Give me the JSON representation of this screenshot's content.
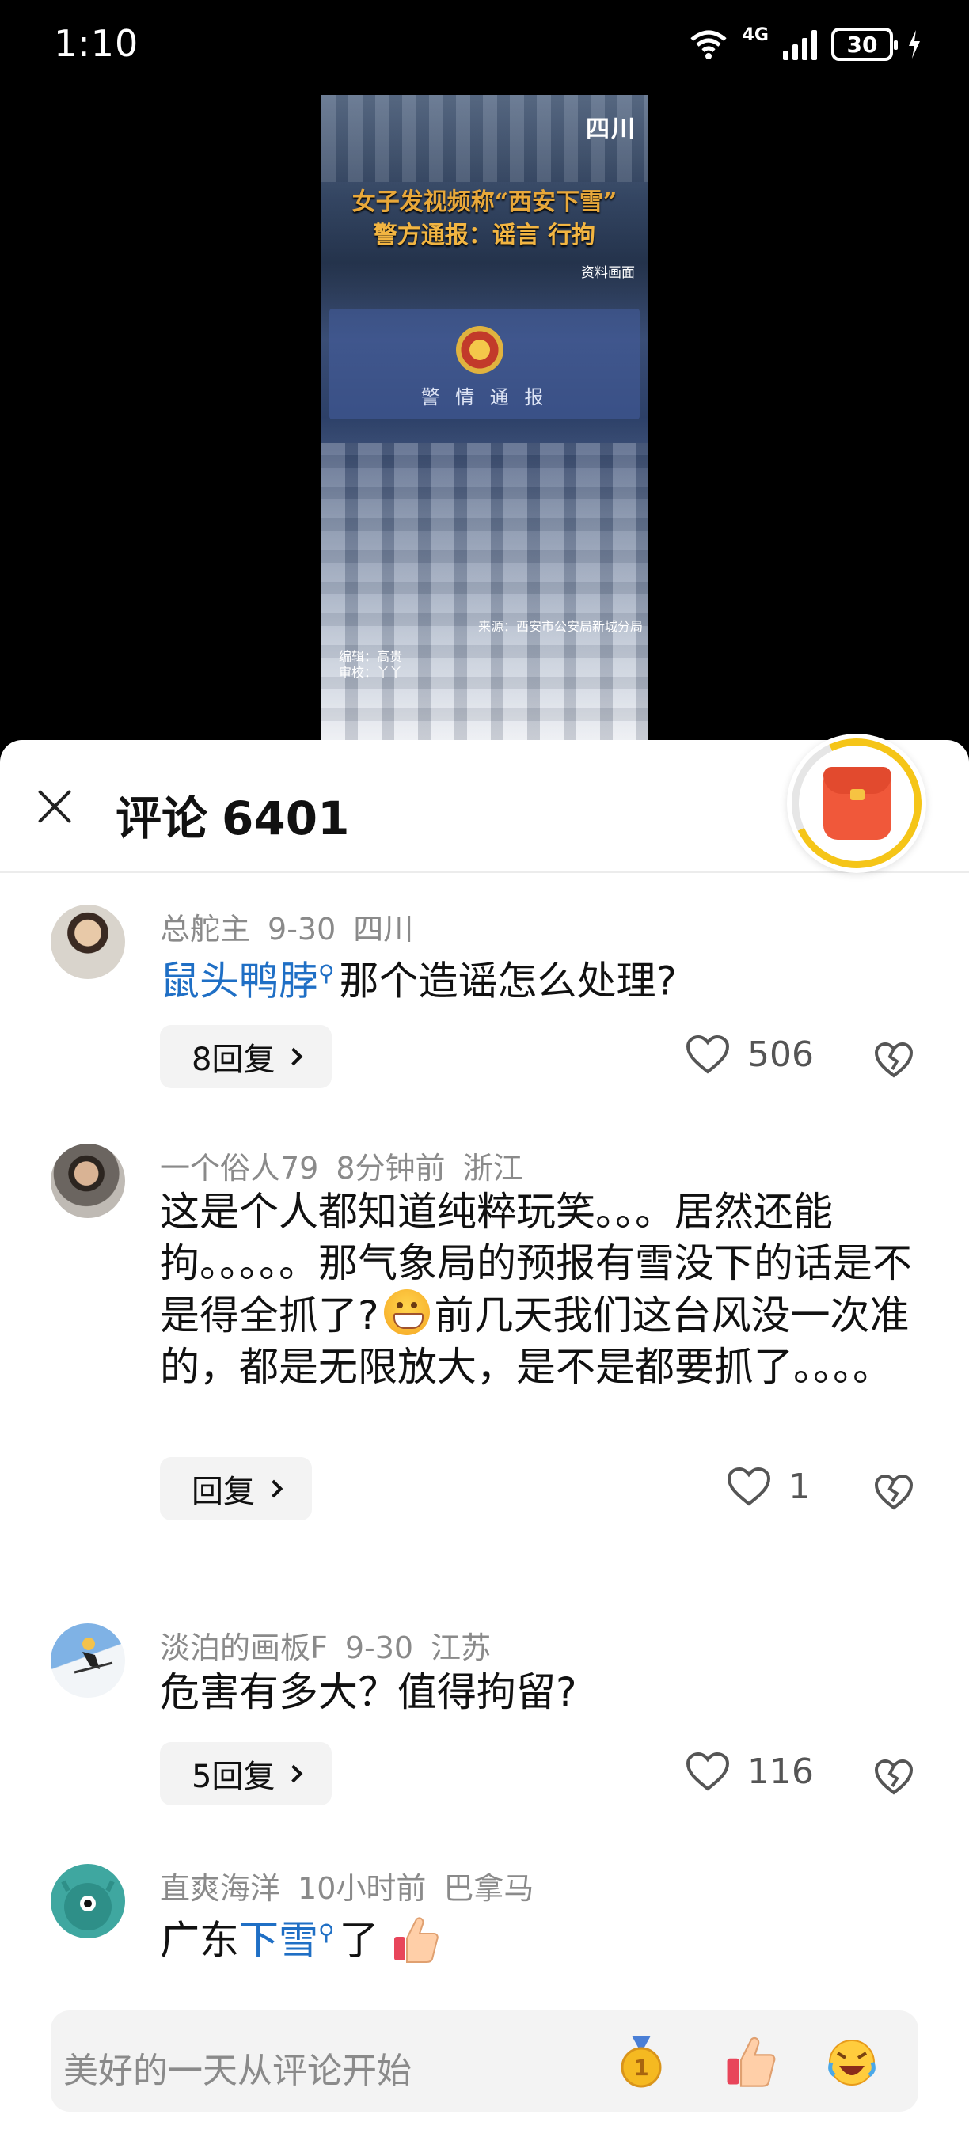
{
  "status_bar": {
    "time": "1:10",
    "network_label": "4G",
    "wifi_label": "6",
    "battery": "30"
  },
  "video": {
    "logo": "四川",
    "headline_line1": "女子发视频称“西安下雪”",
    "headline_line2": "警方通报：谣言 行拘",
    "stock_note": "资料画面",
    "police_banner": "警 情 通 报",
    "source": "来源：西安市公安局新城分局",
    "editor": "编辑：高贵",
    "reviewer": "审校：丫丫"
  },
  "panel": {
    "title": "评论",
    "count": "6401"
  },
  "comments": [
    {
      "user": "总舵主",
      "date": "9-30",
      "location": "四川",
      "link_text": "鼠头鸭脖",
      "text": "那个造谣怎么处理?",
      "reply_label": "8回复",
      "likes": "506"
    },
    {
      "user": "一个俗人79",
      "date": "8分钟前",
      "location": "浙江",
      "text_part1": "这是个人都知道纯粹玩笑。。。居然还能拘。。。。。那气象局的预报有雪没下的话是不是得全抓了?",
      "text_part2": "前几天我们这台风没一次准的，都是无限放大，是不是都要抓了。。。。",
      "reply_label": "回复",
      "likes": "1"
    },
    {
      "user": "淡泊的画板F",
      "date": "9-30",
      "location": "江苏",
      "text": "危害有多大？值得拘留?",
      "reply_label": "5回复",
      "likes": "116"
    },
    {
      "user": "直爽海洋",
      "date": "10小时前",
      "location": "巴拿马",
      "text_prefix": "广东",
      "link_text": "下雪",
      "text_suffix": "了"
    }
  ],
  "input": {
    "placeholder": "美好的一天从评论开始"
  },
  "icons": {
    "close": "close-icon",
    "like": "heart-icon",
    "dislike": "broken-heart-icon",
    "search": "search-icon"
  },
  "colors": {
    "link": "#1f6fc5",
    "red_packet_ring": "#f5c518",
    "red_packet": "#f0583a"
  }
}
